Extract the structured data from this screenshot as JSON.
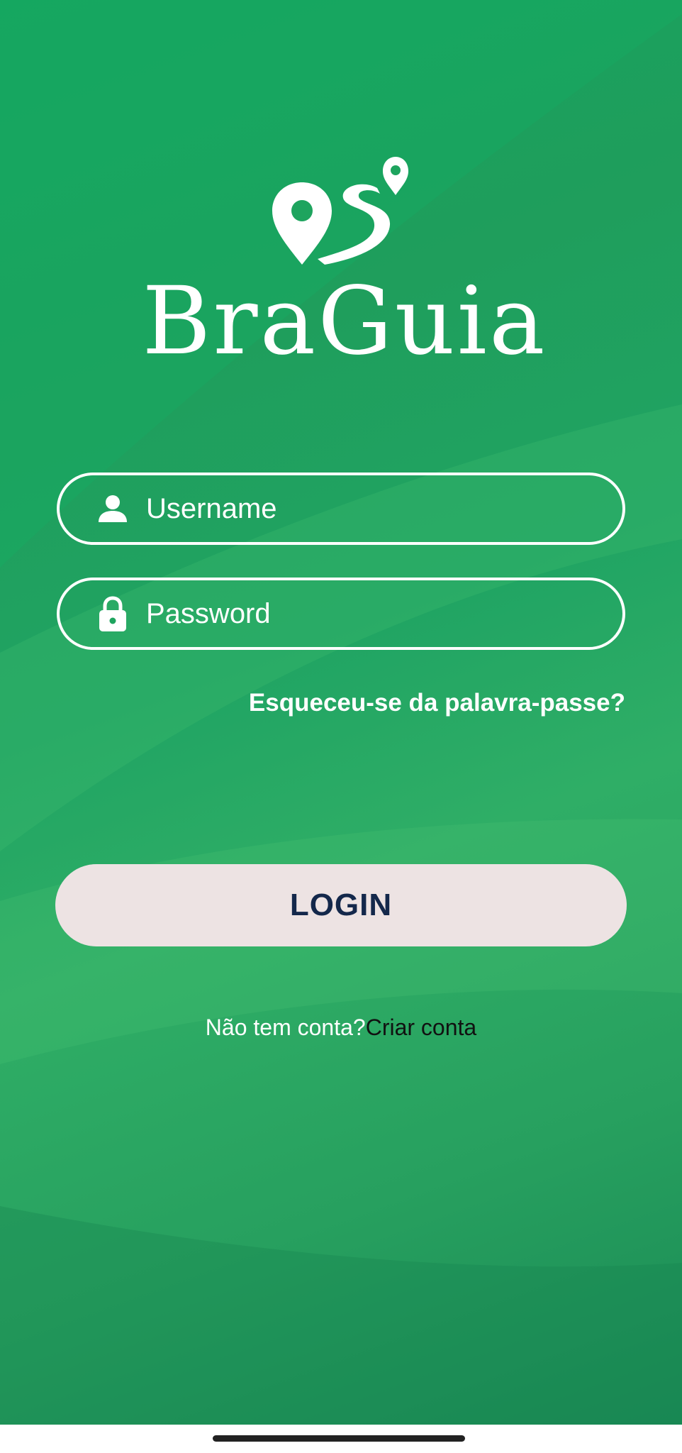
{
  "app": {
    "name": "BraGuia",
    "logo_icon": "map-pin-route-icon"
  },
  "login_form": {
    "username": {
      "placeholder": "Username",
      "value": "",
      "icon": "person-icon"
    },
    "password": {
      "placeholder": "Password",
      "value": "",
      "icon": "lock-icon"
    },
    "forgot_password_label": "Esqueceu-se da palavra-passe?",
    "login_label": "LOGIN"
  },
  "signup": {
    "question": "Não tem conta?",
    "link_label": "Criar conta"
  },
  "colors": {
    "background": "#1fa45e",
    "button_background": "#ede3e3",
    "button_text": "#14284b",
    "link_text": "#111111"
  }
}
